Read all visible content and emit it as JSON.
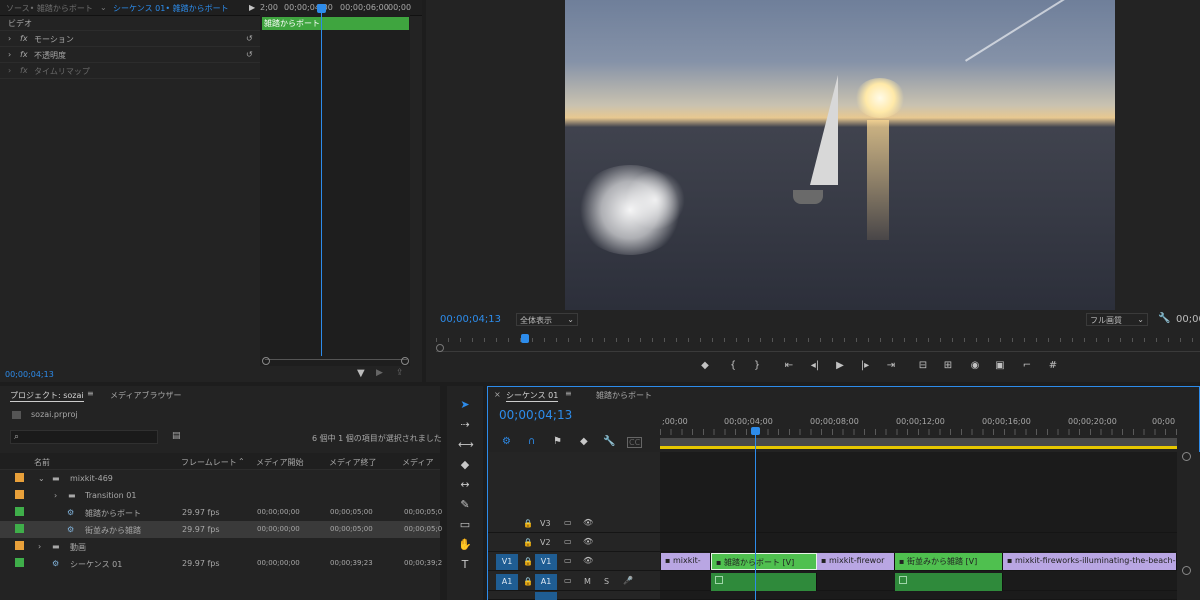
{
  "effect_controls": {
    "tab_source": "ソース• 雑踏からボート",
    "tab_sequence": "シーケンス 01• 雑踏からボート",
    "ruler_times": [
      "2;00",
      "00;00;04;00",
      "00;00;06;00",
      "00;00"
    ],
    "clip_name": "雑踏からボート",
    "section_video": "ビデオ",
    "fx_label": "fx",
    "effects": [
      "モーション",
      "不透明度",
      "タイムリマップ"
    ],
    "timecode": "00;00;04;13"
  },
  "program": {
    "timecode": "00;00;04;13",
    "fit": "全体表示",
    "quality": "フル画質",
    "duration": "00;00"
  },
  "project": {
    "tab_project": "プロジェクト: sozai",
    "tab_media_browser": "メディアブラウザー",
    "file_name": "sozai.prproj",
    "selection_info": "6 個中 1 個の項目が選択されました",
    "columns": [
      "名前",
      "フレームレート",
      "メディア開始",
      "メディア終了",
      "メディア"
    ],
    "items": [
      {
        "name": "mixkit-469",
        "fps": "",
        "start": "",
        "end": "",
        "end2": "",
        "color": "#e8a03a"
      },
      {
        "name": "Transition 01",
        "fps": "",
        "start": "",
        "end": "",
        "end2": "",
        "color": "#e8a03a"
      },
      {
        "name": "雑踏からボート",
        "fps": "29.97 fps",
        "start": "00;00;00;00",
        "end": "00;00;05;00",
        "end2": "00;00;05;0",
        "color": "#3fae4a"
      },
      {
        "name": "街並みから雑踏",
        "fps": "29.97 fps",
        "start": "00;00;00;00",
        "end": "00;00;05;00",
        "end2": "00;00;05;0",
        "color": "#3fae4a"
      },
      {
        "name": "動画",
        "fps": "",
        "start": "",
        "end": "",
        "end2": "",
        "color": "#e8a03a"
      },
      {
        "name": "シーケンス 01",
        "fps": "29.97 fps",
        "start": "00;00;00;00",
        "end": "00;00;39;23",
        "end2": "00;00;39;2",
        "color": "#3fae4a"
      }
    ]
  },
  "timeline": {
    "tab_sequence": "シーケンス 01",
    "tab_other": "雑踏からボート",
    "timecode": "00;00;04;13",
    "ruler_labels": [
      ";00;00",
      "00;00;04;00",
      "00;00;08;00",
      "00;00;12;00",
      "00;00;16;00",
      "00;00;20;00",
      "00;00"
    ],
    "tracks": {
      "v3": "V3",
      "v2": "V2",
      "v1_src": "V1",
      "v1": "V1",
      "a1_src": "A1",
      "a1": "A1",
      "mute": "M",
      "solo": "S"
    },
    "clips": {
      "c1": "mixkit-",
      "c2": "雑踏からボート [V]",
      "c3": "mixkit-firewor",
      "c4": "街並みから雑踏 [V]",
      "c5": "mixkit-fireworks-illuminating-the-beach-"
    }
  }
}
